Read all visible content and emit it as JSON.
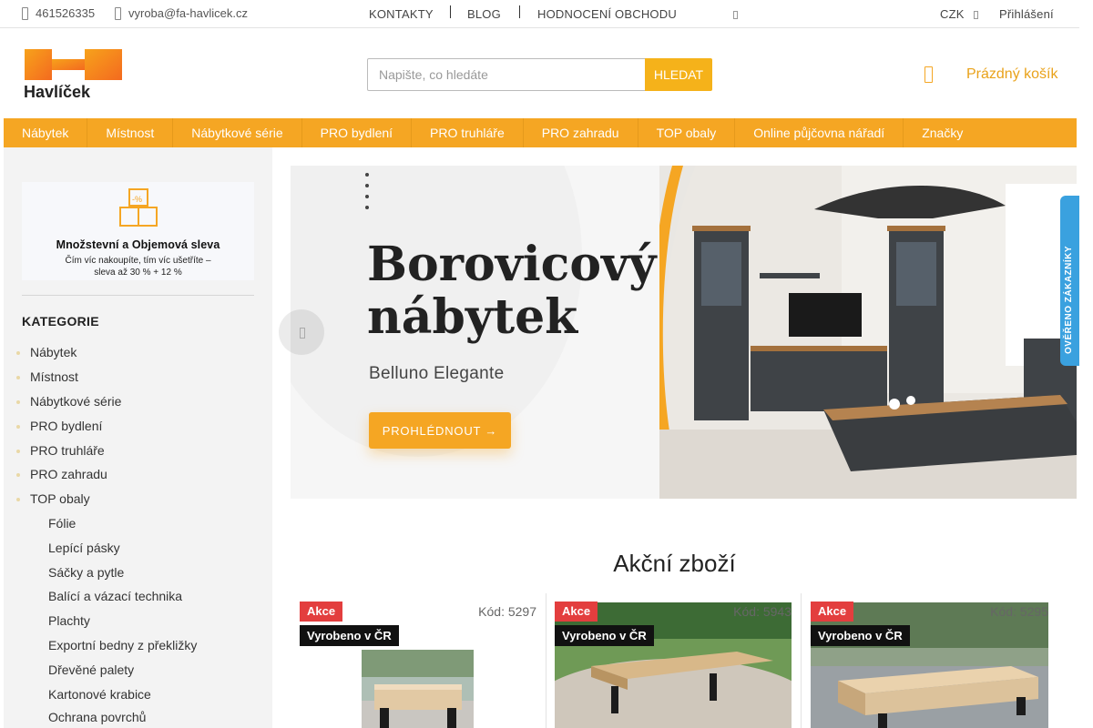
{
  "topbar": {
    "phone": "461526335",
    "email": "vyroba@fa-havlicek.cz",
    "links": [
      "KONTAKTY",
      "BLOG",
      "HODNOCENÍ OBCHODU"
    ],
    "currency": "CZK",
    "login": "Přihlášení"
  },
  "header": {
    "logo_text": "Havlíček",
    "search_placeholder": "Napište, co hledáte",
    "search_button": "HLEDAT",
    "cart_label": "Prázdný košík"
  },
  "mainnav": [
    "Nábytek",
    "Místnost",
    "Nábytkové série",
    "PRO bydlení",
    "PRO truhláře",
    "PRO zahradu",
    "TOP obaly",
    "Online půjčovna nářadí",
    "Značky"
  ],
  "sidebar": {
    "promo_title": "Množstevní a Objemová sleva",
    "promo_line1": "Čím víc nakoupíte, tím víc ušetříte –",
    "promo_line2": "sleva až 30 % + 12 %",
    "categories_heading": "KATEGORIE",
    "categories": [
      "Nábytek",
      "Místnost",
      "Nábytkové série",
      "PRO bydlení",
      "PRO truhláře",
      "PRO zahradu",
      "TOP obaly"
    ],
    "subcategories": [
      "Fólie",
      "Lepící pásky",
      "Sáčky a pytle",
      "Balící a vázací technika",
      "Plachty",
      "Exportní bedny z překližky",
      "Dřevěné palety",
      "Kartonové krabice",
      "Ochrana povrchů"
    ]
  },
  "hero": {
    "title_line1": "Borovicový",
    "title_line2": "nábytek",
    "subtitle": "Belluno Elegante",
    "button": "PROHLÉDNOUT  →"
  },
  "verified_badge": "OVĚŘENO ZÁKAZNÍKY",
  "section_title": "Akční zboží",
  "products": [
    {
      "badge1": "Akce",
      "badge2": "Vyrobeno v ČR",
      "code": "Kód: 5297"
    },
    {
      "badge1": "Akce",
      "badge2": "Vyrobeno v ČR",
      "code": "Kód: 5943"
    },
    {
      "badge1": "Akce",
      "badge2": "Vyrobeno v ČR",
      "code": "Kód: 5295"
    }
  ],
  "colors": {
    "accent": "#f5a623",
    "sale": "#e33e3e",
    "verified": "#3aa1df"
  }
}
